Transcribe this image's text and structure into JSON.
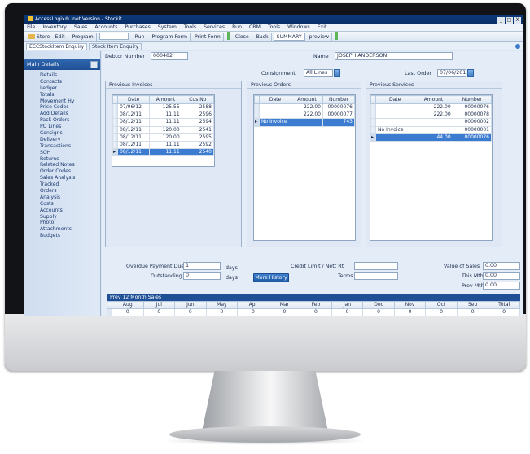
{
  "window": {
    "title": "AccessLogix® Inet Version - Stockit",
    "buttons": [
      "_",
      "□",
      "X"
    ]
  },
  "menu": [
    "File",
    "Inventory",
    "Sales",
    "Accounts",
    "Purchases",
    "System",
    "Tools",
    "Services",
    "Run",
    "CRM",
    "Tools",
    "Windows",
    "Exit"
  ],
  "toolbar": {
    "store_edit": "Store - Edit",
    "program_label": "Program",
    "run": "Run",
    "program_form": "Program Form",
    "print_form": "Print Form",
    "close": "Close",
    "back": "Back",
    "summary": "SUMMARY",
    "preview": "preview"
  },
  "tabs": [
    "ECCStockItem Enquiry",
    "Stock Item Enquiry"
  ],
  "sidebar": {
    "header": "Main Details",
    "items": [
      "Details",
      "Contacts",
      "Ledger",
      "Totals",
      "Movement Hy",
      "Price Codes",
      "Add Details",
      "Pack Orders",
      "PO Lines",
      "Consigns",
      "Delivery",
      "Transactions",
      "SOH",
      "Returns",
      "Related Notes",
      "Order Codes",
      "Sales Analysis",
      "Tracked",
      "Orders",
      "Analysis",
      "Costs",
      "Accounts",
      "Supply",
      "Photo",
      "Attachments",
      "Budgets"
    ]
  },
  "main": {
    "debtor_label": "Debtor Number",
    "debtor_number": "000482",
    "name_label": "Name",
    "name_value": "JOSEPH ANDERSON",
    "consign_label": "Consignment",
    "consign_value": "All Lines",
    "last_order_label": "Last Order",
    "last_order_value": "07/06/2012"
  },
  "invoices": {
    "title": "Previous Invoices",
    "columns": [
      "Date",
      "Amount",
      "Cus No"
    ],
    "rows": [
      [
        "07/06/12",
        "125.55",
        "2588"
      ],
      [
        "08/12/11",
        "11.11",
        "2596"
      ],
      [
        "08/12/11",
        "11.11",
        "2594"
      ],
      [
        "08/12/11",
        "120.00",
        "2541"
      ],
      [
        "08/12/11",
        "120.00",
        "2595"
      ],
      [
        "08/12/11",
        "11.11",
        "2592"
      ],
      [
        "08/12/11",
        "11.11",
        "2540"
      ]
    ]
  },
  "orders": {
    "title": "Previous Orders",
    "columns": [
      "Date",
      "Amount",
      "Number"
    ],
    "rows": [
      [
        "",
        "222.00",
        "00000076"
      ],
      [
        "",
        "222.00",
        "00000077"
      ],
      [
        "No Invoice",
        "",
        "743"
      ]
    ]
  },
  "services": {
    "title": "Previous Services",
    "columns": [
      "Date",
      "Amount",
      "Number"
    ],
    "rows": [
      [
        "",
        "222.00",
        "00000076"
      ],
      [
        "",
        "222.00",
        "00000078"
      ],
      [
        "",
        "",
        "00000002"
      ],
      [
        "No Invoice",
        "",
        "00000001"
      ],
      [
        "",
        "44.00",
        "00000076"
      ]
    ]
  },
  "summary": {
    "overdue_label": "Overdue Payment Due",
    "overdue_value": "1",
    "outstanding_label": "Outstanding",
    "outstanding_value": "0",
    "days_label": "days",
    "days_label2": "days",
    "more_history": "More History",
    "credit_limit_label": "Credit Limit / Nett Rt",
    "credit_limit_value": "",
    "terms_label": "Terms",
    "terms_value": "",
    "value_of_sales_label": "Value of Sales",
    "value_of_sales_value": "0.00",
    "this_mth_label": "This Mth",
    "this_mth_value": "0.00",
    "prev_mth_label": "Prev Mth",
    "prev_mth_value": "0.00"
  },
  "months": {
    "title": "Prev 12 Month Sales",
    "columns": [
      "Aug",
      "Jul",
      "Jun",
      "May",
      "Apr",
      "Mar",
      "Feb",
      "Jan",
      "Dec",
      "Nov",
      "Oct",
      "Sep",
      "Total"
    ],
    "values": [
      "0",
      "0",
      "0",
      "0",
      "0",
      "0",
      "0",
      "0",
      "0",
      "0",
      "0",
      "0",
      "0"
    ]
  }
}
